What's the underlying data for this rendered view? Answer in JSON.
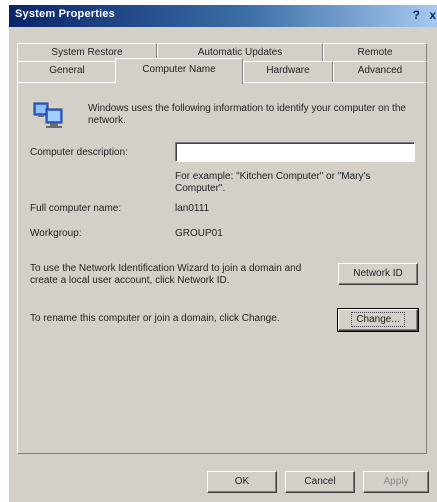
{
  "window": {
    "title": "System Properties",
    "help_glyph": "?",
    "close_glyph": "x"
  },
  "tabs_row1": [
    {
      "label": "System Restore"
    },
    {
      "label": "Automatic Updates"
    },
    {
      "label": "Remote"
    }
  ],
  "tabs_row2": [
    {
      "label": "General"
    },
    {
      "label": "Computer Name"
    },
    {
      "label": "Hardware"
    },
    {
      "label": "Advanced"
    }
  ],
  "active_tab": "Computer Name",
  "panel": {
    "intro_text": "Windows uses the following information to identify your computer on the network.",
    "description_label": "Computer description:",
    "description_value": "",
    "example_text": "For example: \"Kitchen Computer\" or \"Mary's Computer\".",
    "full_name_label": "Full computer name:",
    "full_name_value": "lan0111",
    "workgroup_label": "Workgroup:",
    "workgroup_value": "GROUP01",
    "network_id_text": "To use the Network Identification Wizard to join a domain and create a local user account, click Network ID.",
    "network_id_button": "Network ID",
    "change_text": "To rename this computer or join a domain, click Change.",
    "change_button": "Change..."
  },
  "footer": {
    "ok": "OK",
    "cancel": "Cancel",
    "apply": "Apply"
  },
  "colors": {
    "dialog": "#d4d0c8",
    "title_start": "#0a246a",
    "title_end": "#a6caf0"
  }
}
